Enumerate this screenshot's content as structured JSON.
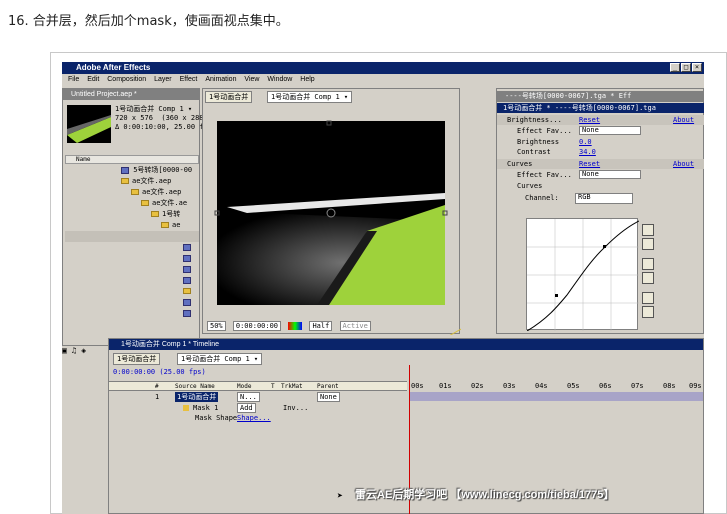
{
  "caption": "16. 合并层，然后加个mask，使画面视点集中。",
  "window": {
    "title": "Adobe After Effects",
    "min": "_",
    "max": "□",
    "close": "×"
  },
  "menu": [
    "File",
    "Edit",
    "Composition",
    "Layer",
    "Effect",
    "Animation",
    "View",
    "Window",
    "Help"
  ],
  "project": {
    "title": "Untitled Project.aep *",
    "comp_name": "1号动画合并 Comp 1 ▾",
    "comp_size": "720 x 576  (360 x 288)",
    "comp_duration": "Δ 0:00:10:00, 25.00 fps",
    "name_header": "Name",
    "items": [
      {
        "label": "5号转场[0000-00",
        "indent": 56,
        "type": "comp"
      },
      {
        "label": "ae文件.aep",
        "indent": 56,
        "type": "folder"
      },
      {
        "label": "ae文件.aep",
        "indent": 66,
        "type": "folder"
      },
      {
        "label": "ae文件.ae",
        "indent": 76,
        "type": "folder"
      },
      {
        "label": "1号转",
        "indent": 86,
        "type": "folder"
      },
      {
        "label": "ae",
        "indent": 96,
        "type": "folder"
      }
    ]
  },
  "comp": {
    "tab_inactive": "1号动画合并",
    "tab_active": "1号动画合并 Comp 1 ▾",
    "zoom": "50%",
    "timecode": "0:00:00:00",
    "resolution": "Half",
    "active": "Active"
  },
  "effects": {
    "title": "----号转场[0000-0067].tga * Eff",
    "subtitle": "1号动画合并 * ----号转场[0000-0067].tga",
    "brightness_label": "Brightness...",
    "reset": "Reset",
    "about": "About",
    "effect_fav": "Effect Fav...",
    "none": "None",
    "brightness": "Brightness",
    "brightness_val": "0.0",
    "contrast": "Contrast",
    "contrast_val": "34.0",
    "curves_label": "Curves",
    "curves": "Curves",
    "channel": "Channel:",
    "channel_val": "RGB"
  },
  "timeline": {
    "title": "1号动画合并 Comp 1 * Timeline",
    "tab1": "1号动画合并",
    "tab2": "1号动画合并 Comp 1 ▾",
    "time": "0:00:00:00 (25.00 fps)",
    "columns": {
      "num": "#",
      "source": "Source Name",
      "mode": "Mode",
      "t": "T",
      "trkmat": "TrkMat",
      "parent": "Parent"
    },
    "layer": {
      "num": "1",
      "name": "1号动画合并",
      "mode": "N...",
      "parent": "None"
    },
    "mask": {
      "name": "Mask 1",
      "mode": "Add",
      "inv": "Inv..."
    },
    "mask_shape": {
      "label": "Mask Shape",
      "value": "Shape..."
    },
    "ruler": [
      "00s",
      "01s",
      "02s",
      "03s",
      "04s",
      "05s",
      "06s",
      "07s",
      "08s",
      "09s"
    ]
  },
  "watermark": "雷云AE后期学习吧 【www.linecg.com/tieba/1775】",
  "colors": {
    "titlebar": "#0a246a",
    "panel": "#d4d0c8",
    "green": "#9ed23b",
    "playhead": "#d00000"
  }
}
